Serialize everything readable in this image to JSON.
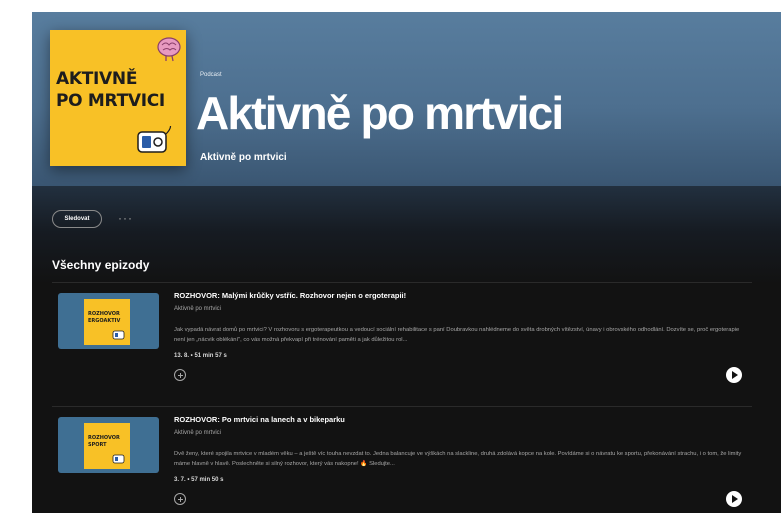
{
  "podcast": {
    "type_label": "Podcast",
    "title": "Aktivně po mrtvici",
    "author": "Aktivně po mrtvici",
    "cover_lines": [
      "AKTIVNĚ",
      "PO MRTVICI"
    ]
  },
  "actions": {
    "follow_label": "Sledovat",
    "more_label": "···"
  },
  "section": {
    "title": "Všechny epizody"
  },
  "episodes": [
    {
      "thumb_lines": [
        "ROZHOVOR",
        "ERGOAKTIV"
      ],
      "title": "ROZHOVOR: Malými krůčky vstříc. Rozhovor nejen o ergoterapii!",
      "show": "Aktivně po mrtvici",
      "description": "Jak vypadá návrat domů po mrtvici? V rozhovoru s ergoterapeutkou a vedoucí sociální rehabilitace s paní Doubravkou nahlédneme do světa drobných vítězství, únavy i obrovského odhodlání. Dozvíte se, proč ergoterapie není jen „nácvik oblékání\", co vás možná překvapí při trénování paměti a jak důležitou rol...",
      "meta": "13. 8. • 51 min 57 s"
    },
    {
      "thumb_lines": [
        "ROZHOVOR",
        "SPORT"
      ],
      "title": "ROZHOVOR: Po mrtvici na lanech a v bikeparku",
      "show": "Aktivně po mrtvici",
      "description": "Dvě ženy, které spojila mrtvice v mladém věku – a ještě víc touha nevzdat to. Jedna balancuje ve výškách na slackline, druhá zdolává kopce na kole. Povídáme si o návratu ke sportu, překonávání strachu, i o tom, že limity máme hlavně v hlavě. Poslechněte si silný rozhovor, který vás nakopne! 🔥 Sledujte...",
      "meta": "3. 7. • 57 min 50 s"
    }
  ],
  "colors": {
    "hero_blue": "#587d9e",
    "cover_yellow": "#f8c126",
    "background": "#121212",
    "muted_text": "#a7a7a7"
  },
  "icons": [
    "brain-icon",
    "device-icon",
    "more-icon",
    "add-icon",
    "play-icon"
  ]
}
